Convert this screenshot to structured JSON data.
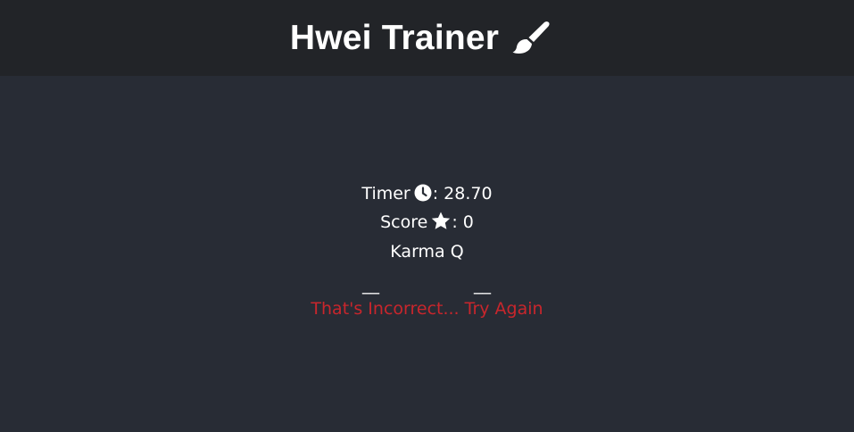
{
  "header": {
    "title": "Hwei Trainer",
    "title_icon": "paintbrush-icon"
  },
  "stats": {
    "timer_label": "Timer",
    "timer_icon": "clock-icon",
    "timer_value": ": 28.70",
    "score_label": "Score",
    "score_icon": "star-icon",
    "score_value": ": 0"
  },
  "prompt": {
    "spell": "Karma Q"
  },
  "answer": {
    "blank_1": "__",
    "blank_2": "__"
  },
  "feedback": {
    "message": "That's Incorrect... Try Again",
    "color": "#c9262c"
  },
  "colors": {
    "header_bg": "#222428",
    "page_bg": "#282c35",
    "text": "#ffffff"
  }
}
